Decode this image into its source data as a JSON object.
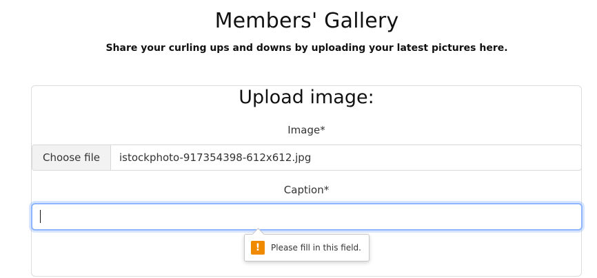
{
  "header": {
    "title": "Members' Gallery",
    "subtitle": "Share your curling ups and downs by uploading your latest pictures here."
  },
  "upload_panel": {
    "title": "Upload image:",
    "image_label": "Image*",
    "file_button_label": "Choose file",
    "file_name": "istockphoto-917354398-612x612.jpg",
    "caption_label": "Caption*",
    "caption_value": "",
    "validation_message": "Please fill in this field."
  },
  "icons": {
    "warning_icon": "warning-icon"
  },
  "colors": {
    "focus_border": "#8db5ff",
    "warning_icon": "#f08a00"
  }
}
